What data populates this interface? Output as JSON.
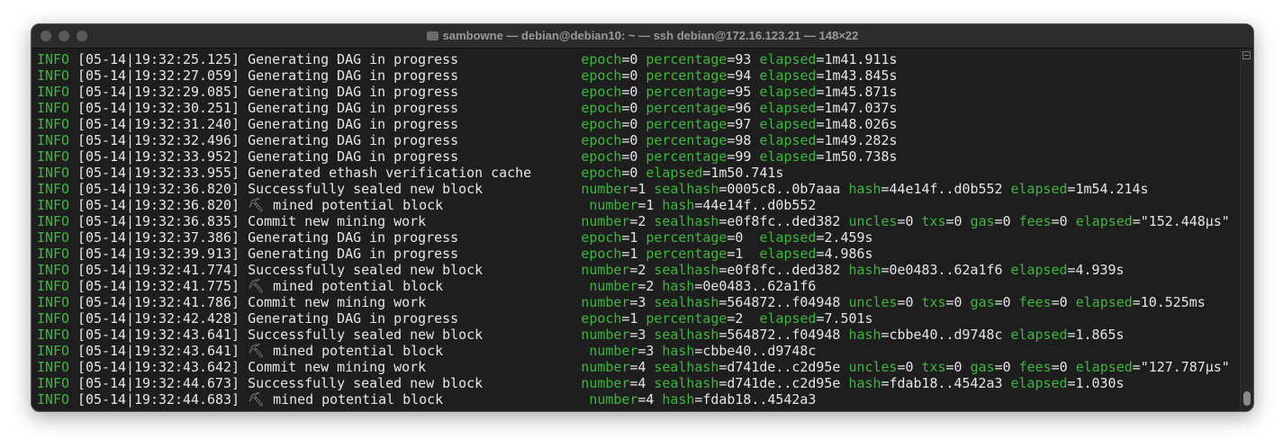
{
  "window": {
    "title": "sambowne — debian@debian10: ~ — ssh debian@172.16.123.21 — 148×22"
  },
  "colors": {
    "key": "#3cb73c",
    "text": "#e6e6e6",
    "background": "#1e1e1e"
  },
  "lines": [
    {
      "level": "INFO",
      "time": "[05-14|19:32:25.125]",
      "msg": "Generating DAG in progress",
      "fields": [
        [
          "epoch",
          "0"
        ],
        [
          "percentage",
          "93"
        ],
        [
          "elapsed",
          "1m41.911s"
        ]
      ]
    },
    {
      "level": "INFO",
      "time": "[05-14|19:32:27.059]",
      "msg": "Generating DAG in progress",
      "fields": [
        [
          "epoch",
          "0"
        ],
        [
          "percentage",
          "94"
        ],
        [
          "elapsed",
          "1m43.845s"
        ]
      ]
    },
    {
      "level": "INFO",
      "time": "[05-14|19:32:29.085]",
      "msg": "Generating DAG in progress",
      "fields": [
        [
          "epoch",
          "0"
        ],
        [
          "percentage",
          "95"
        ],
        [
          "elapsed",
          "1m45.871s"
        ]
      ]
    },
    {
      "level": "INFO",
      "time": "[05-14|19:32:30.251]",
      "msg": "Generating DAG in progress",
      "fields": [
        [
          "epoch",
          "0"
        ],
        [
          "percentage",
          "96"
        ],
        [
          "elapsed",
          "1m47.037s"
        ]
      ]
    },
    {
      "level": "INFO",
      "time": "[05-14|19:32:31.240]",
      "msg": "Generating DAG in progress",
      "fields": [
        [
          "epoch",
          "0"
        ],
        [
          "percentage",
          "97"
        ],
        [
          "elapsed",
          "1m48.026s"
        ]
      ]
    },
    {
      "level": "INFO",
      "time": "[05-14|19:32:32.496]",
      "msg": "Generating DAG in progress",
      "fields": [
        [
          "epoch",
          "0"
        ],
        [
          "percentage",
          "98"
        ],
        [
          "elapsed",
          "1m49.282s"
        ]
      ]
    },
    {
      "level": "INFO",
      "time": "[05-14|19:32:33.952]",
      "msg": "Generating DAG in progress",
      "fields": [
        [
          "epoch",
          "0"
        ],
        [
          "percentage",
          "99"
        ],
        [
          "elapsed",
          "1m50.738s"
        ]
      ]
    },
    {
      "level": "INFO",
      "time": "[05-14|19:32:33.955]",
      "msg": "Generated ethash verification cache",
      "fields": [
        [
          "epoch",
          "0"
        ],
        [
          "elapsed",
          "1m50.741s"
        ]
      ]
    },
    {
      "level": "INFO",
      "time": "[05-14|19:32:36.820]",
      "msg": "Successfully sealed new block",
      "fields": [
        [
          "number",
          "1"
        ],
        [
          "sealhash",
          "0005c8..0b7aaa"
        ],
        [
          "hash",
          "44e14f..d0b552"
        ],
        [
          "elapsed",
          "1m54.214s"
        ]
      ]
    },
    {
      "level": "INFO",
      "time": "[05-14|19:32:36.820]",
      "icon": "⛏",
      "msg": " mined potential block",
      "fields": [
        [
          "number",
          "1"
        ],
        [
          "hash",
          "44e14f..d0b552"
        ]
      ]
    },
    {
      "level": "INFO",
      "time": "[05-14|19:32:36.835]",
      "msg": "Commit new mining work",
      "fields": [
        [
          "number",
          "2"
        ],
        [
          "sealhash",
          "e0f8fc..ded382"
        ],
        [
          "uncles",
          "0"
        ],
        [
          "txs",
          "0"
        ],
        [
          "gas",
          "0"
        ],
        [
          "fees",
          "0"
        ],
        [
          "elapsed",
          "\"152.448µs\""
        ]
      ]
    },
    {
      "level": "INFO",
      "time": "[05-14|19:32:37.386]",
      "msg": "Generating DAG in progress",
      "fields": [
        [
          "epoch",
          "1"
        ],
        [
          "percentage",
          "0 "
        ],
        [
          "elapsed",
          "2.459s"
        ]
      ]
    },
    {
      "level": "INFO",
      "time": "[05-14|19:32:39.913]",
      "msg": "Generating DAG in progress",
      "fields": [
        [
          "epoch",
          "1"
        ],
        [
          "percentage",
          "1 "
        ],
        [
          "elapsed",
          "4.986s"
        ]
      ]
    },
    {
      "level": "INFO",
      "time": "[05-14|19:32:41.774]",
      "msg": "Successfully sealed new block",
      "fields": [
        [
          "number",
          "2"
        ],
        [
          "sealhash",
          "e0f8fc..ded382"
        ],
        [
          "hash",
          "0e0483..62a1f6"
        ],
        [
          "elapsed",
          "4.939s"
        ]
      ]
    },
    {
      "level": "INFO",
      "time": "[05-14|19:32:41.775]",
      "icon": "⛏",
      "msg": " mined potential block",
      "fields": [
        [
          "number",
          "2"
        ],
        [
          "hash",
          "0e0483..62a1f6"
        ]
      ]
    },
    {
      "level": "INFO",
      "time": "[05-14|19:32:41.786]",
      "msg": "Commit new mining work",
      "fields": [
        [
          "number",
          "3"
        ],
        [
          "sealhash",
          "564872..f04948"
        ],
        [
          "uncles",
          "0"
        ],
        [
          "txs",
          "0"
        ],
        [
          "gas",
          "0"
        ],
        [
          "fees",
          "0"
        ],
        [
          "elapsed",
          "10.525ms"
        ]
      ]
    },
    {
      "level": "INFO",
      "time": "[05-14|19:32:42.428]",
      "msg": "Generating DAG in progress",
      "fields": [
        [
          "epoch",
          "1"
        ],
        [
          "percentage",
          "2 "
        ],
        [
          "elapsed",
          "7.501s"
        ]
      ]
    },
    {
      "level": "INFO",
      "time": "[05-14|19:32:43.641]",
      "msg": "Successfully sealed new block",
      "fields": [
        [
          "number",
          "3"
        ],
        [
          "sealhash",
          "564872..f04948"
        ],
        [
          "hash",
          "cbbe40..d9748c"
        ],
        [
          "elapsed",
          "1.865s"
        ]
      ]
    },
    {
      "level": "INFO",
      "time": "[05-14|19:32:43.641]",
      "icon": "⛏",
      "msg": " mined potential block",
      "fields": [
        [
          "number",
          "3"
        ],
        [
          "hash",
          "cbbe40..d9748c"
        ]
      ]
    },
    {
      "level": "INFO",
      "time": "[05-14|19:32:43.642]",
      "msg": "Commit new mining work",
      "fields": [
        [
          "number",
          "4"
        ],
        [
          "sealhash",
          "d741de..c2d95e"
        ],
        [
          "uncles",
          "0"
        ],
        [
          "txs",
          "0"
        ],
        [
          "gas",
          "0"
        ],
        [
          "fees",
          "0"
        ],
        [
          "elapsed",
          "\"127.787µs\""
        ]
      ]
    },
    {
      "level": "INFO",
      "time": "[05-14|19:32:44.673]",
      "msg": "Successfully sealed new block",
      "fields": [
        [
          "number",
          "4"
        ],
        [
          "sealhash",
          "d741de..c2d95e"
        ],
        [
          "hash",
          "fdab18..4542a3"
        ],
        [
          "elapsed",
          "1.030s"
        ]
      ]
    },
    {
      "level": "INFO",
      "time": "[05-14|19:32:44.683]",
      "icon": "⛏",
      "msg": " mined potential block",
      "fields": [
        [
          "number",
          "4"
        ],
        [
          "hash",
          "fdab18..4542a3"
        ]
      ]
    }
  ]
}
